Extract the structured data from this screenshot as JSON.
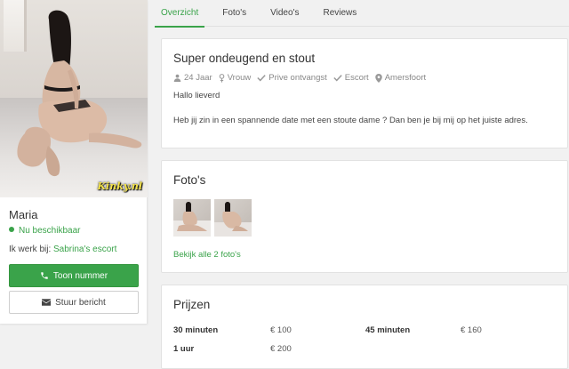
{
  "profile": {
    "name": "Maria",
    "availability": "Nu beschikbaar",
    "works_at_label": "Ik werk bij:",
    "works_at_link": "Sabrina's escort",
    "watermark": "Kinky.nl",
    "call_button": "Toon nummer",
    "message_button": "Stuur bericht"
  },
  "tabs": [
    {
      "label": "Overzicht",
      "active": true
    },
    {
      "label": "Foto's"
    },
    {
      "label": "Video's"
    },
    {
      "label": "Reviews"
    }
  ],
  "intro": {
    "title": "Super ondeugend en stout",
    "meta": {
      "age": "24 Jaar",
      "gender": "Vrouw",
      "receives": "Prive ontvangst",
      "type": "Escort",
      "location": "Amersfoort"
    },
    "greeting": "Hallo lieverd",
    "description": "Heb jij zin in een spannende date met een stoute dame ? Dan ben je bij mij op het juiste adres."
  },
  "photos": {
    "title": "Foto's",
    "view_all": "Bekijk alle 2 foto's"
  },
  "prices": {
    "title": "Prijzen",
    "items": [
      {
        "label": "30 minuten",
        "value": "€ 100"
      },
      {
        "label": "45 minuten",
        "value": "€ 160"
      },
      {
        "label": "1 uur",
        "value": "€ 200"
      }
    ]
  },
  "colors": {
    "accent": "#3aa34a",
    "background": "#f1f1f1"
  }
}
